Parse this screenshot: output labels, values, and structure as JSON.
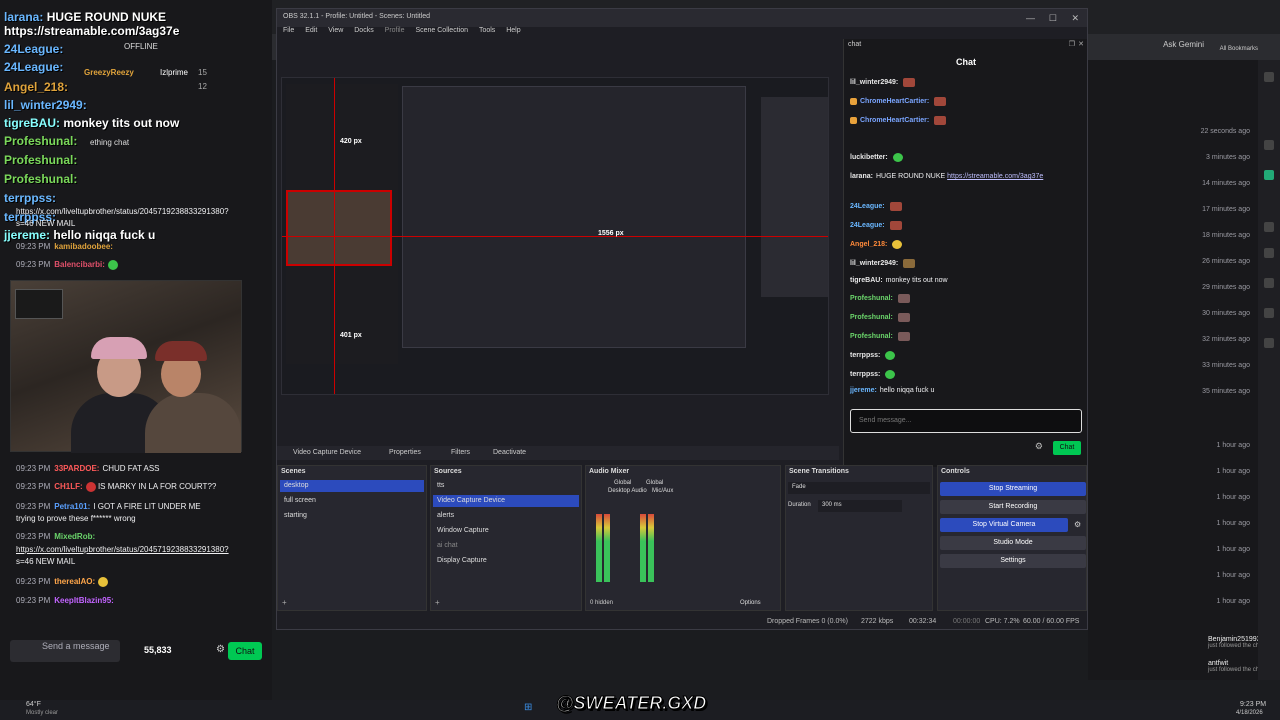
{
  "stream_overlay": {
    "lines": [
      {
        "user": "larana:",
        "text": "HUGE ROUND NUKE"
      },
      {
        "user": "",
        "text": "https://streamable.com/3ag37e"
      },
      {
        "user": "24League:",
        "text": ""
      },
      {
        "user": "24League:",
        "text": ""
      },
      {
        "user": "Angel_218:",
        "text": ""
      },
      {
        "user": "lil_winter2949:",
        "text": ""
      },
      {
        "user": "tigreBAU:",
        "text": "monkey tits out now"
      },
      {
        "user": "Profeshunal:",
        "text": ""
      },
      {
        "user": "Profeshunal:",
        "text": ""
      },
      {
        "user": "Profeshunal:",
        "text": ""
      },
      {
        "user": "terrppss:",
        "text": ""
      },
      {
        "user": "terrppss:",
        "text": ""
      },
      {
        "user": "jjereme:",
        "text": "hello niqqa fuck u"
      }
    ],
    "offline": "OFFLINE",
    "popup_users": [
      "GreezyReezy",
      "Izlprime"
    ],
    "popup_counts": [
      "15",
      "12"
    ],
    "popup_text": "ething chat",
    "chat_messages": [
      {
        "time": "09:23 PM",
        "user": "33PARDOE:",
        "text": "CHUD FAT ASS"
      },
      {
        "time": "09:23 PM",
        "user": "CH1LF:",
        "text": "IS MARKY IN LA FOR COURT??"
      },
      {
        "time": "09:23 PM",
        "user": "Petra101:",
        "text": "I GOT A FIRE LIT UNDER ME"
      },
      {
        "time": "",
        "user": "",
        "text": "trying to prove these f****** wrong"
      },
      {
        "time": "09:23 PM",
        "user": "MixedRob:",
        "text": ""
      },
      {
        "time": "",
        "user": "",
        "text": "https://x.com/liveltupbrother/status/2045719238833291380?"
      },
      {
        "time": "",
        "user": "",
        "text": "s=46 NEW MAIL"
      },
      {
        "time": "09:23 PM",
        "user": "therealAO:",
        "text": ""
      },
      {
        "time": "09:23 PM",
        "user": "KeepItBlazin95:",
        "text": ""
      }
    ],
    "overlap_lines": [
      {
        "time": "",
        "user": "",
        "text": "https://x.com/liveltupbrother/status/2045719238833291380?"
      },
      {
        "time": "",
        "user": "",
        "text": "s=46 NEW MAIL"
      },
      {
        "time": "09:23 PM",
        "user": "kamibadoobee:",
        "text": ""
      },
      {
        "time": "09:23 PM",
        "user": "Balencibarbi:",
        "text": ""
      }
    ],
    "send_placeholder": "Send a message",
    "viewers": "55,833",
    "chat_button": "Chat"
  },
  "browser": {
    "ask_gemini": "Ask Gemini",
    "all_bookmarks": "All Bookmarks",
    "times": [
      "22 seconds ago",
      "3 minutes ago",
      "14 minutes ago",
      "17 minutes ago",
      "18 minutes ago",
      "26 minutes ago",
      "29 minutes ago",
      "30 minutes ago",
      "32 minutes ago",
      "33 minutes ago",
      "35 minutes ago",
      "1 hour ago",
      "1 hour ago",
      "1 hour ago",
      "1 hour ago",
      "1 hour ago",
      "1 hour ago",
      "1 hour ago"
    ],
    "follows": [
      {
        "user": "Benjamin251993",
        "text": "just followed the channel"
      },
      {
        "user": "antfwit",
        "text": "just followed the channel"
      }
    ]
  },
  "obs": {
    "title": "OBS 32.1.1 - Profile: Untitled - Scenes: Untitled",
    "menu": [
      "File",
      "Edit",
      "View",
      "Docks",
      "Profile",
      "Scene Collection",
      "Tools",
      "Help"
    ],
    "preview_labels": {
      "w": "1556 px",
      "h": "401 px",
      "top": "420 px"
    },
    "chat": {
      "dock_title": "chat",
      "title": "Chat",
      "messages": [
        {
          "user": "lil_winter2949:",
          "text": ""
        },
        {
          "user": "ChromeHeartCartier:",
          "text": ""
        },
        {
          "user": "ChromeHeartCartier:",
          "text": ""
        },
        {
          "user": "luckibetter:",
          "text": ""
        },
        {
          "user": "larana:",
          "text": "HUGE ROUND NUKE",
          "link": "https://streamable.com/3ag37e"
        },
        {
          "user": "24League:",
          "text": ""
        },
        {
          "user": "24League:",
          "text": ""
        },
        {
          "user": "Angel_218:",
          "text": ""
        },
        {
          "user": "lil_winter2949:",
          "text": ""
        },
        {
          "user": "tigreBAU:",
          "text": "monkey tits out now"
        },
        {
          "user": "Profeshunal:",
          "text": ""
        },
        {
          "user": "Profeshunal:",
          "text": ""
        },
        {
          "user": "Profeshunal:",
          "text": ""
        },
        {
          "user": "terrppss:",
          "text": ""
        },
        {
          "user": "terrppss:",
          "text": ""
        },
        {
          "user": "jjereme:",
          "text": "hello niqqa fuck u"
        }
      ],
      "placeholder": "Send message...",
      "send": "Chat"
    },
    "source_bar": {
      "name": "Video Capture Device",
      "properties": "Properties",
      "filters": "Filters",
      "deactivate": "Deactivate"
    },
    "scenes": {
      "header": "Scenes",
      "items": [
        "desktop",
        "full screen",
        "starting"
      ]
    },
    "sources": {
      "header": "Sources",
      "items": [
        "tts",
        "Video Capture Device",
        "alerts",
        "Window Capture",
        "ai chat",
        "Display Capture"
      ]
    },
    "mixer": {
      "header": "Audio Mixer",
      "channels": [
        "Desktop Audio",
        "Mic/Aux"
      ],
      "global": "Global",
      "hidden": "0 hidden",
      "options": "Options"
    },
    "transitions": {
      "header": "Scene Transitions",
      "type": "Fade",
      "duration_label": "Duration",
      "duration": "300 ms"
    },
    "controls": {
      "header": "Controls",
      "buttons": [
        "Stop Streaming",
        "Start Recording",
        "Stop Virtual Camera",
        "Studio Mode",
        "Settings"
      ]
    },
    "status": {
      "dropped": "Dropped Frames 0 (0.0%)",
      "kbps": "2722 kbps",
      "stream_time": "00:32:34",
      "rec_time": "00:00:00",
      "cpu": "CPU: 7.2%",
      "fps": "60.00 / 60.00 FPS"
    }
  },
  "taskbar": {
    "weather_temp": "64°F",
    "weather": "Mostly clear",
    "clock": "9:23 PM",
    "date": "4/18/2026",
    "logo": "@SWEATER.GXD"
  },
  "colors": {
    "accent": "#2c4bbd",
    "twitch_green": "#00c853"
  }
}
